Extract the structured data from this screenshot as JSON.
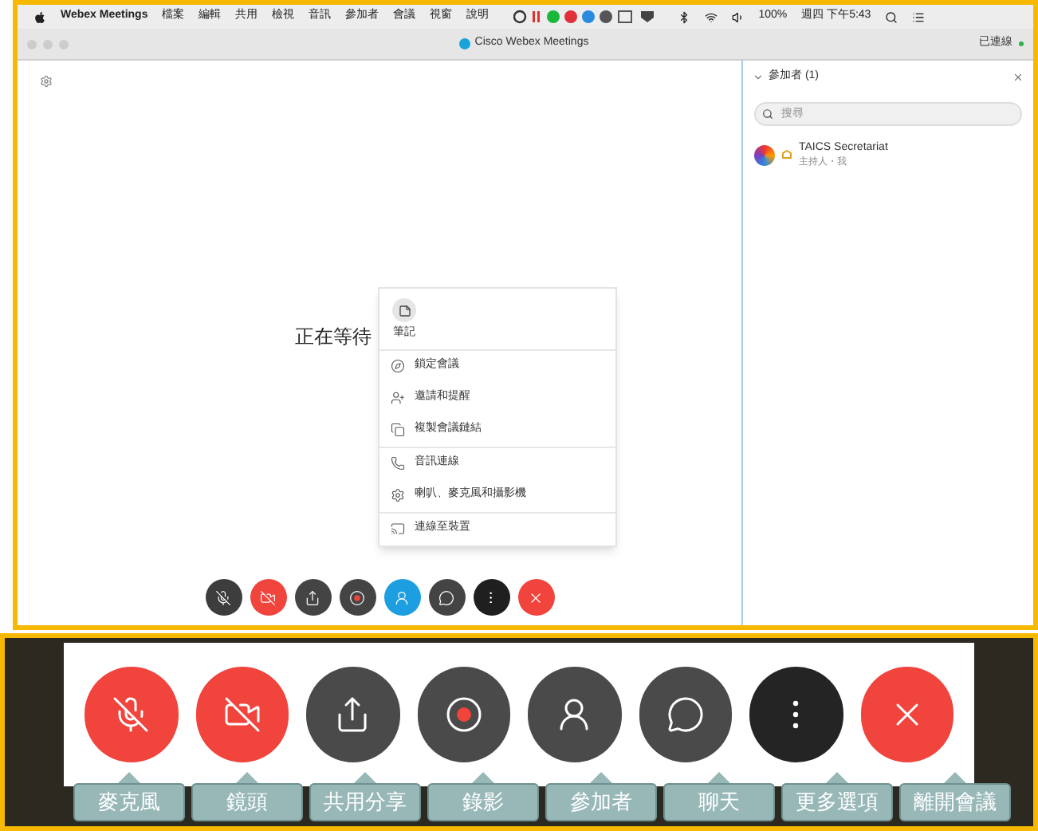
{
  "menu_bar": {
    "app": "Webex Meetings",
    "items": [
      "檔案",
      "編輯",
      "共用",
      "檢視",
      "音訊",
      "參加者",
      "會議",
      "視窗",
      "說明"
    ],
    "battery": "100%",
    "clock": "週四 下午5:43"
  },
  "window": {
    "title": "Cisco Webex Meetings",
    "status": "已連線"
  },
  "main": {
    "waiting_text": "正在等待",
    "more_menu": {
      "top_item": "筆記",
      "groups": [
        {
          "items": [
            {
              "kind": "lock",
              "label": "鎖定會議"
            },
            {
              "kind": "invite",
              "label": "邀請和提醒"
            },
            {
              "kind": "copy",
              "label": "複製會議鏈結"
            }
          ]
        },
        {
          "items": [
            {
              "kind": "phone",
              "label": "音訊連線"
            },
            {
              "kind": "settings",
              "label": "喇叭、麥克風和攝影機"
            }
          ]
        },
        {
          "items": [
            {
              "kind": "cast",
              "label": "連線至裝置"
            }
          ]
        }
      ]
    },
    "toolbar": [
      {
        "kind": "mic",
        "color": "#3d3d3d"
      },
      {
        "kind": "video",
        "color": "#f0443d"
      },
      {
        "kind": "share",
        "color": "#444444"
      },
      {
        "kind": "record",
        "color": "#444444"
      },
      {
        "kind": "participants",
        "color": "#1d9ee0"
      },
      {
        "kind": "chat",
        "color": "#444444"
      },
      {
        "kind": "more",
        "color": "#1f1f1f"
      },
      {
        "kind": "leave",
        "color": "#f0443d"
      }
    ]
  },
  "participants_panel": {
    "title": "參加者 (1)",
    "search": {
      "placeholder": "搜尋"
    },
    "participants": [
      {
        "name": "TAICS Secretariat",
        "role": "主持人・我"
      }
    ]
  },
  "callout": {
    "toolbar": [
      {
        "kind": "mic",
        "color": "#f0443d",
        "label": "麥克風"
      },
      {
        "kind": "video",
        "color": "#f0443d",
        "label": "鏡頭"
      },
      {
        "kind": "share",
        "color": "#4a4a4a",
        "label": "共用分享"
      },
      {
        "kind": "record",
        "color": "#4a4a4a",
        "label": "錄影"
      },
      {
        "kind": "participants",
        "color": "#4a4a4a",
        "label": "參加者"
      },
      {
        "kind": "chat",
        "color": "#4a4a4a",
        "label": "聊天"
      },
      {
        "kind": "more",
        "color": "#242424",
        "label": "更多選項"
      },
      {
        "kind": "leave",
        "color": "#f0443d",
        "label": "離開會議"
      }
    ]
  }
}
